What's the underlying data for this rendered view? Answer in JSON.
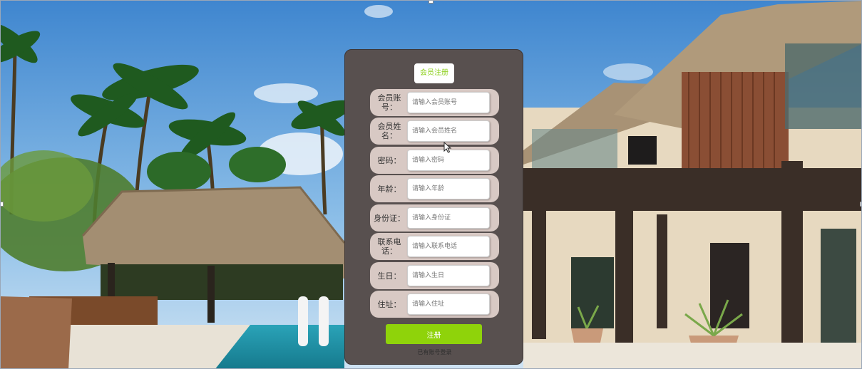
{
  "form": {
    "title": "会员注册",
    "fields": [
      {
        "label": "会员账号：",
        "placeholder": "请输入会员账号"
      },
      {
        "label": "会员姓名：",
        "placeholder": "请输入会员姓名"
      },
      {
        "label": "密码：",
        "placeholder": "请输入密码"
      },
      {
        "label": "年龄：",
        "placeholder": "请输入年龄"
      },
      {
        "label": "身份证：",
        "placeholder": "请输入身份证"
      },
      {
        "label": "联系电话：",
        "placeholder": "请输入联系电话"
      },
      {
        "label": "生日：",
        "placeholder": "请输入生日"
      },
      {
        "label": "住址：",
        "placeholder": "请输入住址"
      }
    ],
    "submit_label": "注册",
    "login_link": "已有账号登录"
  },
  "colors": {
    "panel": "#58504f",
    "field_row": "#d8c9c4",
    "accent_green": "#8fd30a",
    "title_text": "#8ccf1a"
  },
  "background": {
    "scene": "resort-pool-background"
  }
}
